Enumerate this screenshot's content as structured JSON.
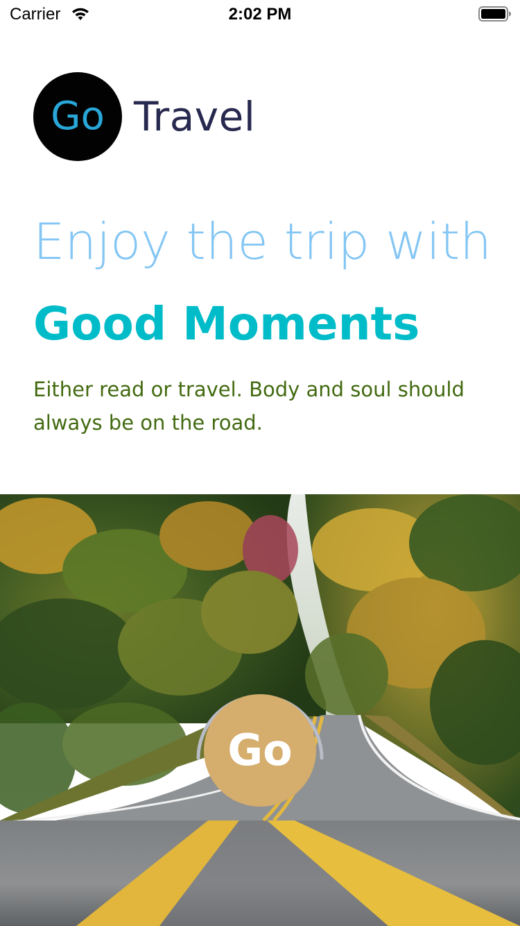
{
  "status_bar": {
    "carrier": "Carrier",
    "time": "2:02 PM",
    "wifi_icon": "wifi-icon",
    "battery_icon": "battery-icon"
  },
  "brand": {
    "logo_text": "Go",
    "name": "Travel",
    "logo_color": "#28a7d8",
    "name_color": "#28294f"
  },
  "hero_text": {
    "line1": "Enjoy the trip with",
    "line2": "Good Moments",
    "tagline": "Either read or travel. Body and soul should always be on the road.",
    "line1_color": "#84c6f4",
    "line2_color": "#00bcc8",
    "tagline_color": "#426a10"
  },
  "hero_image": {
    "description_icon": "road-forest-photo"
  },
  "go_button": {
    "label": "Go",
    "color": "#d5ad6c"
  }
}
